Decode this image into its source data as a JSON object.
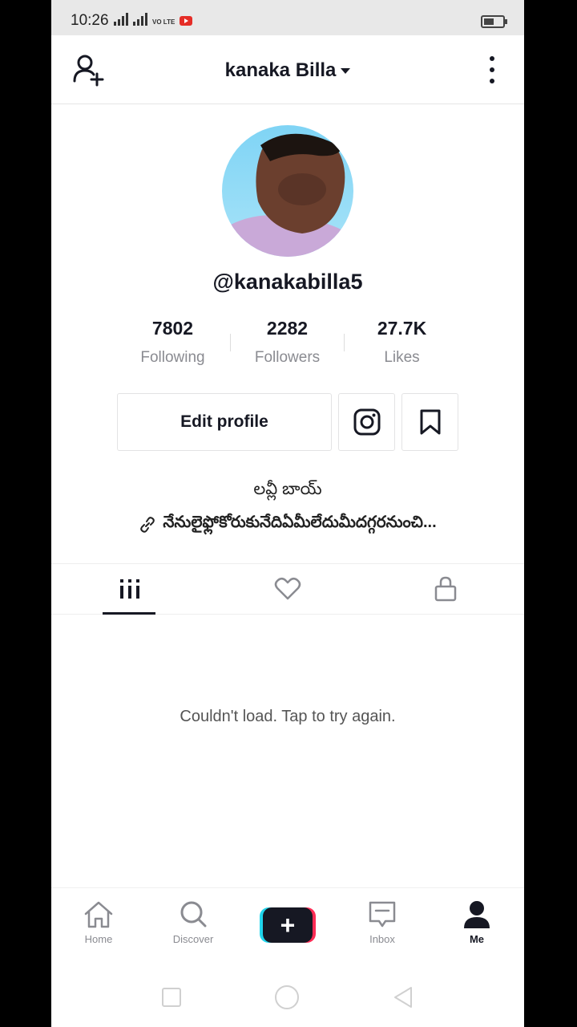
{
  "status_bar": {
    "time": "10:26",
    "network": "4G",
    "volte": "VO LTE"
  },
  "header": {
    "title": "kanaka Billa"
  },
  "profile": {
    "username": "@kanakabilla5",
    "stats": [
      {
        "value": "7802",
        "label": "Following"
      },
      {
        "value": "2282",
        "label": "Followers"
      },
      {
        "value": "27.7K",
        "label": "Likes"
      }
    ],
    "edit_label": "Edit profile",
    "bio": "లవ్లీ బాయ్",
    "link": "నేనులైఫ్లోకోరుకునేదిఏమీలేదుమీదగ్గరనుంచి..."
  },
  "content": {
    "empty_message": "Couldn't load. Tap to try again."
  },
  "bottom_nav": {
    "items": [
      {
        "label": "Home",
        "icon": "home-icon"
      },
      {
        "label": "Discover",
        "icon": "search-icon"
      },
      {
        "label": "+",
        "icon": "create-icon"
      },
      {
        "label": "Inbox",
        "icon": "inbox-icon"
      },
      {
        "label": "Me",
        "icon": "profile-icon"
      }
    ]
  },
  "colors": {
    "accent_cyan": "#20d5ec",
    "accent_pink": "#fe2c55",
    "text_primary": "#161823",
    "text_secondary": "#8a8b91"
  }
}
